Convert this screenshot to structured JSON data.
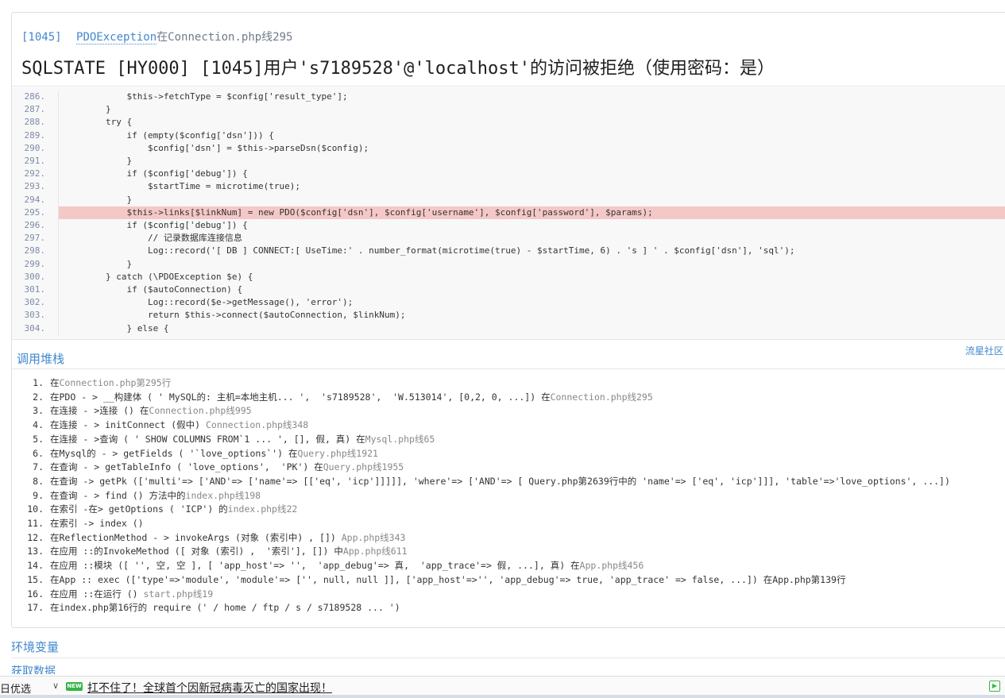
{
  "exception": {
    "code": "[1045]",
    "class_name": "PDOException",
    "location": "在Connection.php线295",
    "message": "SQLSTATE [HY000] [1045]用户's7189528'@'localhost'的访问被拒绝（使用密码：是）"
  },
  "source_lines": [
    {
      "num": "286.",
      "code": "            $this->fetchType = $config['result_type'];"
    },
    {
      "num": "287.",
      "code": "        }"
    },
    {
      "num": "288.",
      "code": "        try {"
    },
    {
      "num": "289.",
      "code": "            if (empty($config['dsn'])) {"
    },
    {
      "num": "290.",
      "code": "                $config['dsn'] = $this->parseDsn($config);"
    },
    {
      "num": "291.",
      "code": "            }"
    },
    {
      "num": "292.",
      "code": "            if ($config['debug']) {"
    },
    {
      "num": "293.",
      "code": "                $startTime = microtime(true);"
    },
    {
      "num": "294.",
      "code": "            }"
    },
    {
      "num": "295.",
      "code": "            $this->links[$linkNum] = new PDO($config['dsn'], $config['username'], $config['password'], $params);"
    },
    {
      "num": "296.",
      "code": "            if ($config['debug']) {"
    },
    {
      "num": "297.",
      "code": "                // 记录数据库连接信息"
    },
    {
      "num": "298.",
      "code": "                Log::record('[ DB ] CONNECT:[ UseTime:' . number_format(microtime(true) - $startTime, 6) . 's ] ' . $config['dsn'], 'sql');"
    },
    {
      "num": "299.",
      "code": "            }"
    },
    {
      "num": "300.",
      "code": "        } catch (\\PDOException $e) {"
    },
    {
      "num": "301.",
      "code": "            if ($autoConnection) {"
    },
    {
      "num": "302.",
      "code": "                Log::record($e->getMessage(), 'error');"
    },
    {
      "num": "303.",
      "code": "                return $this->connect($autoConnection, $linkNum);"
    },
    {
      "num": "304.",
      "code": "            } else {"
    }
  ],
  "highlighted_line": "295.",
  "stack": {
    "title": "调用堆栈",
    "brand": "流星社区",
    "items": [
      {
        "num": "1.",
        "text": "在",
        "extra": "Connection.php第295行"
      },
      {
        "num": "2.",
        "text": "在PDO - > __构建体 ( ' MySQL的: 主机=本地主机... ',  's7189528',  'W.513014', [0,2, 0, ...]) 在",
        "extra": "Connection.php线295"
      },
      {
        "num": "3.",
        "text": "在连接 - >连接 () 在",
        "extra": "Connection.php线995"
      },
      {
        "num": "4.",
        "text": "在连接 - > initConnect (假中) ",
        "extra": "Connection.php线348"
      },
      {
        "num": "5.",
        "text": "在连接 - >查询 ( ' SHOW COLUMNS FROM`1 ... ', [], 假, 真) 在",
        "extra": "Mysql.php线65"
      },
      {
        "num": "6.",
        "text": "在Mysql的 - > getFields ( '`love_options`') 在",
        "extra": "Query.php线1921"
      },
      {
        "num": "7.",
        "text": "在查询 - > getTableInfo ( 'love_options',  'PK') 在",
        "extra": "Query.php线1955"
      },
      {
        "num": "8.",
        "text": "在查询 -> getPk (['multi'=> ['AND'=> ['name'=> [['eq', 'icp']]]]], 'where'=> ['AND'=> [ Query.php第2639行中的 'name'=> ['eq', 'icp']]], 'table'=>'love_options', ...])",
        "extra": ""
      },
      {
        "num": "9.",
        "text": "在查询 - > find () 方法中的",
        "extra": "index.php线198"
      },
      {
        "num": "10.",
        "text": "在索引 -在> getOptions ( 'ICP') 的",
        "extra": "index.php线22"
      },
      {
        "num": "11.",
        "text": "在索引 -> index ()",
        "extra": ""
      },
      {
        "num": "12.",
        "text": "在ReflectionMethod - > invokeArgs (对象 (索引中) , []) ",
        "extra": "App.php线343"
      },
      {
        "num": "13.",
        "text": "在应用 ::的InvokeMethod ([ 对象 (索引) ,  '索引'], []) 中",
        "extra": "App.php线611"
      },
      {
        "num": "14.",
        "text": "在应用 ::模块 ([ '', 空, 空 ], [ 'app_host'=> '',  'app_debug'=> 真,  'app_trace'=> 假, ...], 真) 在",
        "extra": "App.php线456"
      },
      {
        "num": "15.",
        "text": "在App :: exec (['type'=>'module', 'module'=> ['', null, null ]], ['app_host'=>'', 'app_debug'=> true, 'app_trace' => false, ...]) 在App.php第139行",
        "extra": ""
      },
      {
        "num": "16.",
        "text": "在应用 ::在运行 () ",
        "extra": "start.php线19"
      },
      {
        "num": "17.",
        "text": "在index.php第16行的 require (' / home / ftp / s / s7189528 ... ')",
        "extra": ""
      }
    ]
  },
  "env": {
    "title": "环境变量",
    "subtitle": "获取数据"
  },
  "bottom_bar": {
    "left_label": "日优选",
    "badge": "NEW",
    "news": "扛不住了！全球首个因新冠病毒灭亡的国家出现！"
  }
}
